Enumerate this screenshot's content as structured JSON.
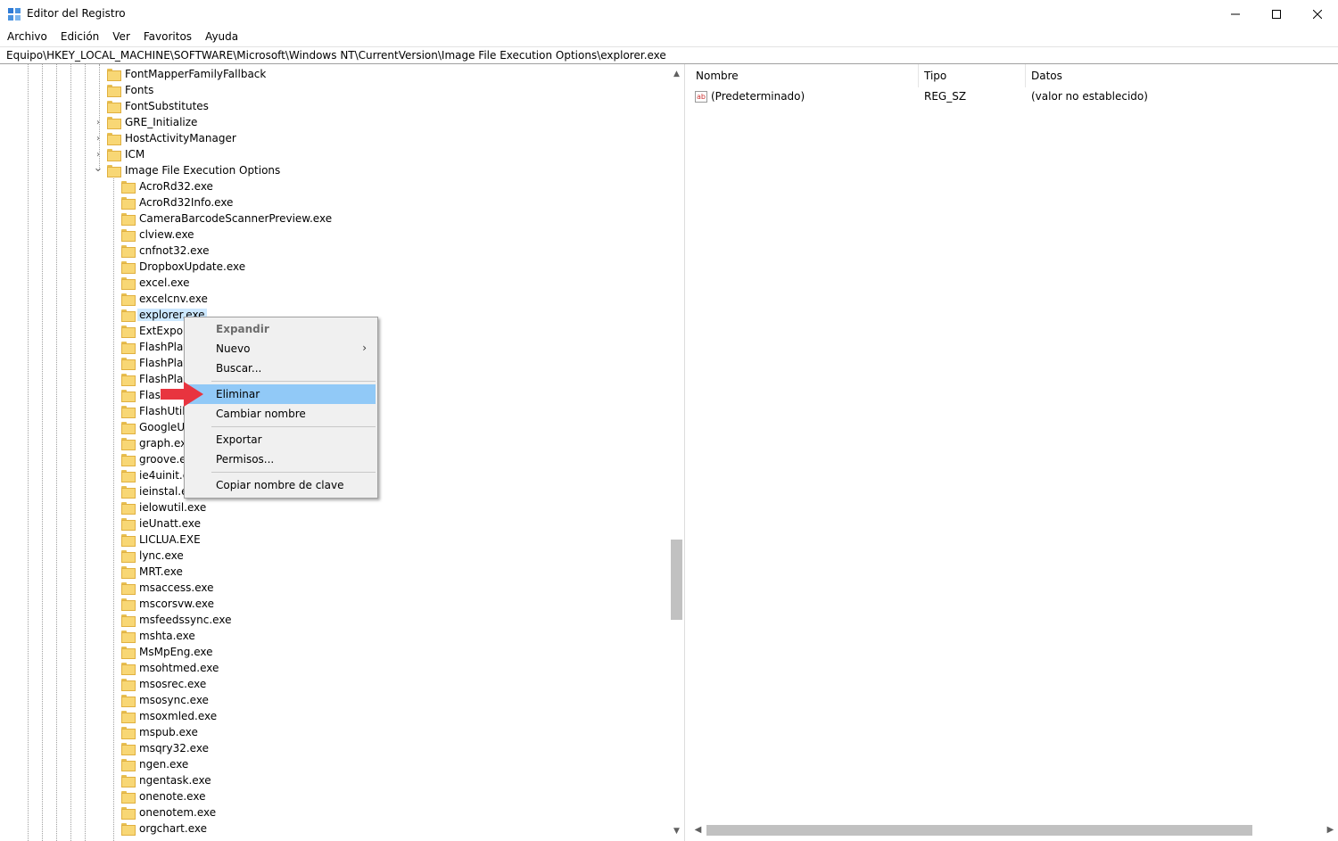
{
  "window": {
    "title": "Editor del Registro"
  },
  "menubar": [
    "Archivo",
    "Edición",
    "Ver",
    "Favoritos",
    "Ayuda"
  ],
  "address": "Equipo\\HKEY_LOCAL_MACHINE\\SOFTWARE\\Microsoft\\Windows NT\\CurrentVersion\\Image File Execution Options\\explorer.exe",
  "tree": {
    "parents": [
      "FontMapperFamilyFallback",
      "Fonts",
      "FontSubstitutes",
      "GRE_Initialize",
      "HostActivityManager",
      "ICM",
      "Image File Execution Options"
    ],
    "children": [
      "AcroRd32.exe",
      "AcroRd32Info.exe",
      "CameraBarcodeScannerPreview.exe",
      "clview.exe",
      "cnfnot32.exe",
      "DropboxUpdate.exe",
      "excel.exe",
      "excelcnv.exe",
      "explorer.exe",
      "ExtExport.",
      "FlashPlaye",
      "FlashPlaye",
      "FlashPlaye",
      "FlashUtil3",
      "FlashUtil6",
      "GoogleUp",
      "graph.exe",
      "groove.ex",
      "ie4uinit.ex",
      "ieinstal.ex",
      "ielowutil.exe",
      "ieUnatt.exe",
      "LICLUA.EXE",
      "lync.exe",
      "MRT.exe",
      "msaccess.exe",
      "mscorsvw.exe",
      "msfeedssync.exe",
      "mshta.exe",
      "MsMpEng.exe",
      "msohtmed.exe",
      "msosrec.exe",
      "msosync.exe",
      "msoxmled.exe",
      "mspub.exe",
      "msqry32.exe",
      "ngen.exe",
      "ngentask.exe",
      "onenote.exe",
      "onenotem.exe",
      "orgchart.exe"
    ],
    "selected": "explorer.exe"
  },
  "list": {
    "columns": [
      "Nombre",
      "Tipo",
      "Datos"
    ],
    "rows": [
      {
        "name": "(Predeterminado)",
        "type": "REG_SZ",
        "data": "(valor no establecido)"
      }
    ]
  },
  "context_menu": {
    "items": [
      "Expandir",
      "Nuevo",
      "Buscar...",
      "Eliminar",
      "Cambiar nombre",
      "Exportar",
      "Permisos...",
      "Copiar nombre de clave"
    ],
    "highlighted": "Eliminar",
    "disabled": "Expandir"
  },
  "colors": {
    "selection": "#cce8ff",
    "menu_hover": "#91c9f7",
    "pointer_arrow": "#e8343f",
    "folder": "#f8d775"
  }
}
